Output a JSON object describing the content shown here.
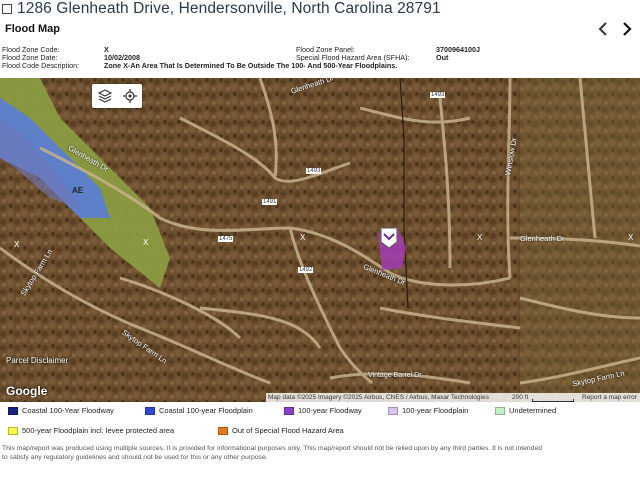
{
  "page": {
    "title": "1286 Glenheath Drive, Hendersonville, North Carolina 28791"
  },
  "header": {
    "title": "Flood Map",
    "prev_icon": "chevron-left-icon",
    "next_icon": "chevron-right-icon"
  },
  "info": {
    "flood_zone_code_label": "Flood Zone Code:",
    "flood_zone_code": "X",
    "flood_zone_date_label": "Flood Zone Date:",
    "flood_zone_date": "10/02/2008",
    "flood_code_description_label": "Flood Code Description:",
    "flood_code_description": "Zone X-An Area That Is Determined To Be Outside The 100- And 500-Year Floodplains.",
    "flood_zone_panel_label": "Flood Zone Panel:",
    "flood_zone_panel": "3700964100J",
    "sfha_label": "Special Flood Hazard Area (SFHA):",
    "sfha": "Out"
  },
  "map": {
    "layers_icon": "layers-icon",
    "locate_icon": "locate-icon",
    "google_logo": "Google",
    "parcel_disclaimer": "Parcel Disclaimer",
    "attribution": "Map data ©2025 Imagery ©2025 Airbus, CNES / Airbus, Maxar Technologies",
    "scale_label": "200 ft",
    "report_error": "Report a map error",
    "zone_label_ae": "AE",
    "zone_label_x": "X",
    "street_labels": {
      "glenheath_dr_top": "Glenheath Dr",
      "glenheath_dr_left": "Glenheath Dr",
      "glenheath_dr_center": "Glenheath Dr",
      "glenheath_dr_right": "Glenheath Dr",
      "winslow_dr": "Winslow Dr",
      "skytop_farm_ln_left": "Skytop Farm Ln",
      "skytop_farm_ln_center": "Skytop Farm Ln",
      "skytop_farm_ln_right": "Skytop Farm Ln",
      "vintage_dr": "Vintage Barrel Dr",
      "route_1493": "1493",
      "route_1493_top": "1493",
      "route_1491": "1491",
      "route_1475": "1475",
      "route_1492": "1492"
    },
    "marker_icon": "map-pin-icon"
  },
  "legend": {
    "items": [
      {
        "label": "Coastal 100-Year Floodway",
        "color": "#1a237e"
      },
      {
        "label": "Coastal 100-year Floodplain",
        "color": "#3347d6"
      },
      {
        "label": "100-year Floodway",
        "color": "#8a3fc7"
      },
      {
        "label": "100-year Floodplain",
        "color": "#d8c5ee"
      },
      {
        "label": "Undetermined",
        "color": "#bff0c8"
      },
      {
        "label": "500-year Floodplain incl. levee protected area",
        "color": "#f5f54a"
      },
      {
        "label": "Out of Special Flood Hazard Area",
        "color": "#e8741e"
      }
    ]
  },
  "disclaimer": {
    "line1": "This map/report was produced using multiple sources. It is provided for informational purposes only. This map/report should not be relied upon by any third parties. It is not intended",
    "line2": "to satisfy any regulatory guidelines and should not be used for this or any other purpose."
  }
}
